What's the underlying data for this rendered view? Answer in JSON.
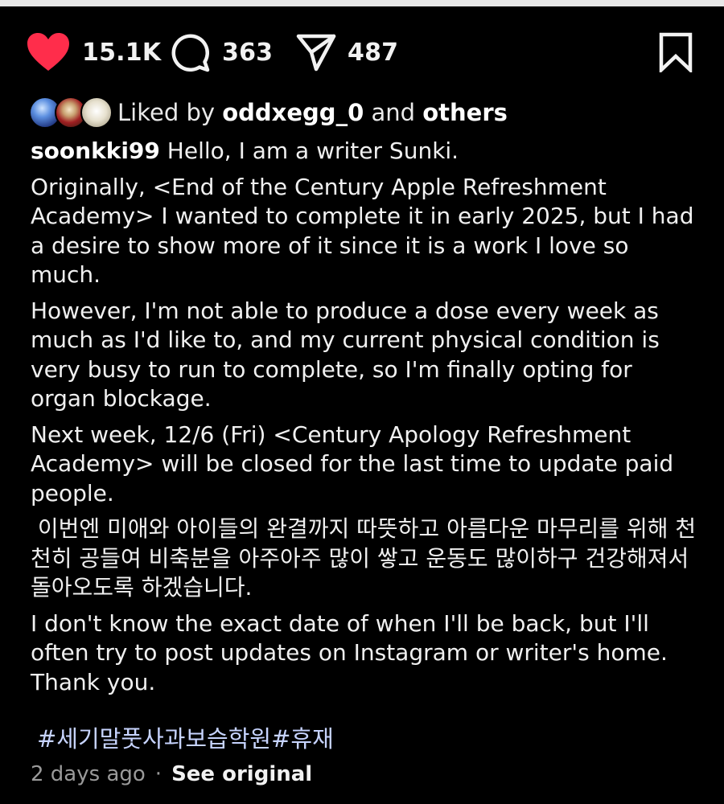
{
  "actions": {
    "likes": "15.1K",
    "comments": "363",
    "shares": "487",
    "like_color": "#ff2d4b"
  },
  "liked_by": {
    "prefix": "Liked by ",
    "user": "oddxegg_0",
    "joiner": " and ",
    "others": "others"
  },
  "caption": {
    "username": "soonkki99",
    "first_line": " Hello, I am a writer Sunki.",
    "paragraphs": [
      "Originally, <End of the Century Apple Refreshment Academy> I wanted to complete it in early 2025, but I had a desire to show more of it since it is a work I love so much.",
      "However, I'm not able to produce a dose every week as much as I'd like to, and my current physical condition is very busy to run to complete, so I'm finally opting for organ blockage.",
      "Next week, 12/6 (Fri) <Century Apology Refreshment Academy> will be closed for the last time to update paid people.",
      " 이번엔 미애와 아이들의 완결까지 따뜻하고 아름다운 마무리를 위해 천천히 공들여 비축분을 아주아주 많이 쌓고 운동도 많이하구 건강해져서 돌아오도록 하겠습니다.",
      "I don't know the exact date of when I'll be back, but I'll often try to post updates on Instagram or writer's home. Thank you."
    ]
  },
  "hashtags": "#세기말풋사과보습학원#휴재",
  "footer": {
    "time": "2 days ago",
    "separator": "·",
    "see_original": "See original"
  }
}
